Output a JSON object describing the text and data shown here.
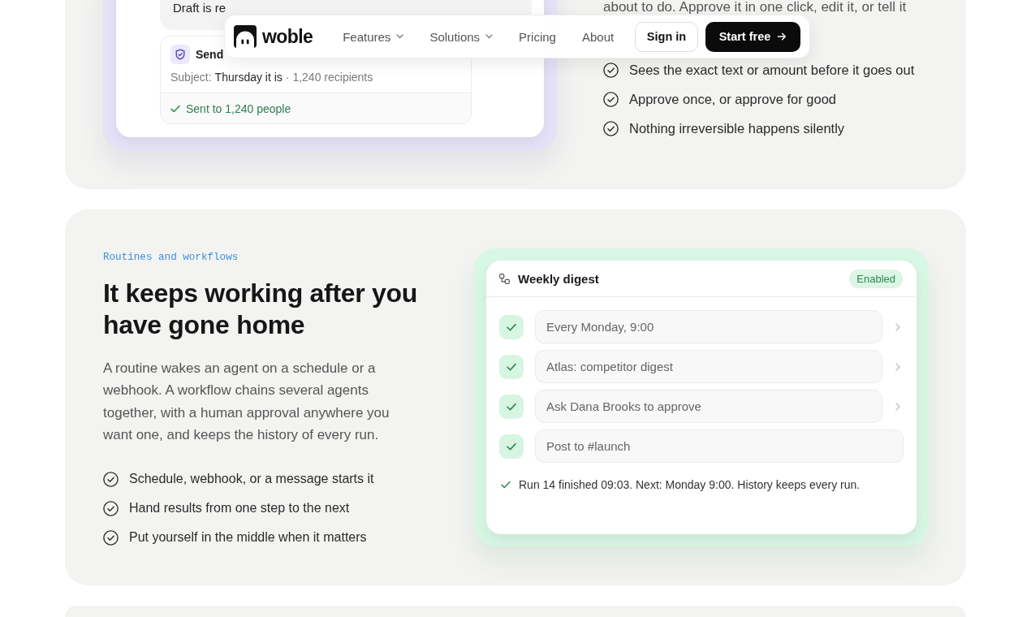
{
  "nav": {
    "logo": "woble",
    "links": [
      {
        "label": "Features",
        "dropdown": true
      },
      {
        "label": "Solutions",
        "dropdown": true
      },
      {
        "label": "Pricing",
        "dropdown": false
      },
      {
        "label": "About",
        "dropdown": false
      }
    ],
    "buttons": [
      {
        "label": "Sign in",
        "kind": "secondary"
      },
      {
        "label": "Start free",
        "kind": "primary"
      }
    ]
  },
  "approval_section": {
    "chat_preview": {
      "message": "Draft is re",
      "action_card": {
        "title": "Send",
        "subject_label": "Subject:",
        "subject": "Thursday it is",
        "meta": "· 1,240 recipients",
        "result": "Sent to 1,240 people"
      }
    },
    "description_line": "about to do. Approve it in one click, edit it, or tell it",
    "points": [
      "Sees the exact text or amount before it goes out",
      "Approve once, or approve for good",
      "Nothing irreversible happens silently"
    ]
  },
  "routines_section": {
    "eyebrow": "Routines and workflows",
    "heading": "It keeps working after you have gone home",
    "body": "A routine wakes an agent on a schedule or a webhook. A workflow chains several agents together, with a human approval anywhere you want one, and keeps the history of every run.",
    "points": [
      "Schedule, webhook, or a message starts it",
      "Hand results from one step to the next",
      "Put yourself in the middle when it matters"
    ],
    "workflow_card": {
      "title": "Weekly digest",
      "status": "Enabled",
      "steps": [
        {
          "label": "Every Monday, 9:00",
          "done": true,
          "has_details": true
        },
        {
          "label": "Atlas: competitor digest",
          "done": true,
          "has_details": true
        },
        {
          "label": "Ask Dana Brooks to approve",
          "done": true,
          "has_details": true
        },
        {
          "label": "Post to #launch",
          "done": true,
          "has_details": false
        }
      ],
      "summary": "Run 14 finished 09:03. Next: Monday 9:00. History keeps every run."
    }
  }
}
